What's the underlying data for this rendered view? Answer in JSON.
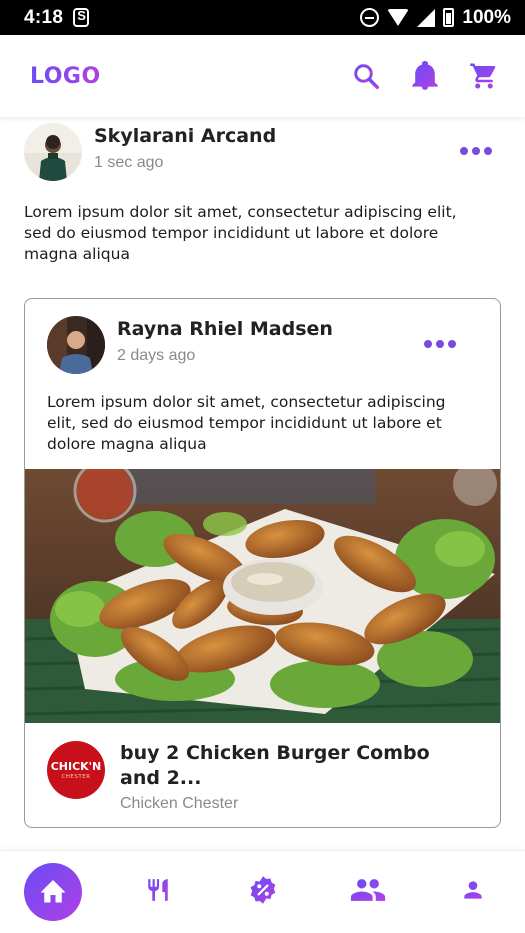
{
  "status_bar": {
    "time": "4:18",
    "battery": "100%"
  },
  "app_bar": {
    "logo": "LOGO",
    "icons": [
      "search-icon",
      "bell-icon",
      "cart-icon"
    ],
    "accent_color": "#8a3ff0"
  },
  "feed": {
    "post1": {
      "author": "Skylarani Arcand",
      "time": "1 sec ago",
      "text": "Lorem ipsum dolor sit amet, consectetur adipiscing elit, sed do eiusmod tempor incididunt ut labore et dolore magna aliqua"
    },
    "post2": {
      "author": "Rayna Rhiel Madsen",
      "time": "2 days ago",
      "text": "Lorem ipsum dolor sit amet, consectetur adipiscing elit, sed do eiusmod tempor incididunt ut labore et dolore magna aliqua",
      "promo": {
        "title": "buy 2 Chicken Burger Combo and 2...",
        "brand": "Chicken Chester",
        "brand_logo_text": "CHICK'N",
        "brand_logo_subtext": "CHESTER"
      }
    }
  },
  "bottom_nav": {
    "items": [
      "home-icon",
      "restaurant-icon",
      "discount-icon",
      "people-icon",
      "profile-icon"
    ],
    "active": "home-icon"
  }
}
